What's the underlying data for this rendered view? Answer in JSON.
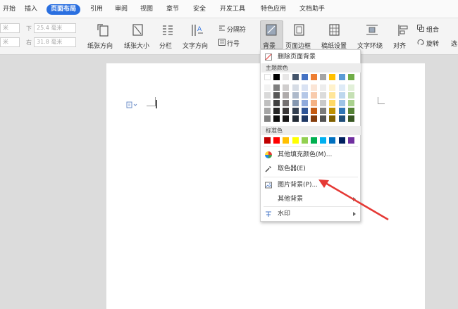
{
  "menubar": {
    "items": [
      "开始",
      "插入",
      "页面布局",
      "引用",
      "审阅",
      "视图",
      "章节",
      "安全",
      "开发工具",
      "特色应用",
      "文档助手"
    ],
    "active_index": 2
  },
  "ribbon": {
    "fields": {
      "top_label": "下",
      "top_value": "25.4 毫米",
      "right_label": "右",
      "right_value": "31.8 毫米",
      "left_value1": "米",
      "left_value2": "米"
    },
    "buttons": {
      "orientation": "纸张方向",
      "size": "纸张大小",
      "columns": "分栏",
      "text_direction": "文字方向",
      "separator": "分隔符",
      "line_number": "行号",
      "background": "背景",
      "border": "页面边框",
      "paper_setting": "稿纸设置",
      "wrap": "文字环绕",
      "align": "对齐",
      "group": "组合",
      "rotate": "旋转",
      "select": "选"
    }
  },
  "dropdown": {
    "remove_bg": "删除页面背景",
    "theme_colors_label": "主题颜色",
    "standard_colors_label": "标准色",
    "more_fill": "其他填充颜色(M)...",
    "picker": "取色器(E)",
    "picture_bg": "图片背景(P)...",
    "other_bg": "其他背景",
    "watermark": "水印",
    "theme_top_row": [
      "#ffffff",
      "#000000",
      "#e7e6e6",
      "#44546a",
      "#4472c4",
      "#ed7d31",
      "#a5a5a5",
      "#ffc000",
      "#5b9bd5",
      "#70ad47"
    ],
    "theme_shades": [
      [
        "#f2f2f2",
        "#7f7f7f",
        "#d0cece",
        "#d6dce5",
        "#d9e2f3",
        "#fbe5d6",
        "#ededed",
        "#fff2cc",
        "#deebf7",
        "#e2f0d9"
      ],
      [
        "#d9d9d9",
        "#595959",
        "#aeabab",
        "#adb9ca",
        "#b4c7e7",
        "#f8cbad",
        "#dbdbdb",
        "#ffe699",
        "#bdd7ee",
        "#c5e0b4"
      ],
      [
        "#bfbfbf",
        "#404040",
        "#757171",
        "#8497b0",
        "#8faadc",
        "#f4b183",
        "#c9c9c9",
        "#ffd966",
        "#9dc3e6",
        "#a9d18e"
      ],
      [
        "#a6a6a6",
        "#262626",
        "#3b3838",
        "#333f50",
        "#2f5597",
        "#c55a11",
        "#7b7b7b",
        "#bf9000",
        "#2e75b6",
        "#548235"
      ],
      [
        "#808080",
        "#0d0d0d",
        "#171616",
        "#222a35",
        "#1f3864",
        "#843c0c",
        "#525252",
        "#7f6000",
        "#1f4e79",
        "#385723"
      ]
    ],
    "standard": [
      "#c00000",
      "#ff0000",
      "#ffc000",
      "#ffff00",
      "#92d050",
      "#00b050",
      "#00b0f0",
      "#0070c0",
      "#002060",
      "#7030a0"
    ]
  },
  "colors": {
    "accent": "#2a6fe0",
    "arrow": "#e53935"
  }
}
